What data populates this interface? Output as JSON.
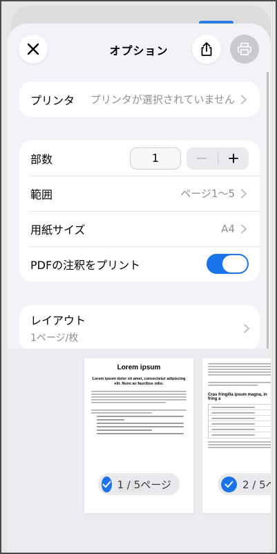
{
  "header": {
    "title": "オプション"
  },
  "printer": {
    "label": "プリンタ",
    "value": "プリンタが選択されていません"
  },
  "settings": {
    "copies_label": "部数",
    "copies_value": "1",
    "range_label": "範囲",
    "range_value": "ページ1〜5",
    "paper_label": "用紙サイズ",
    "paper_value": "A4",
    "annotations_label": "PDFの注釈をプリント",
    "annotations_on": true
  },
  "layout": {
    "label": "レイアウト",
    "value": "1ページ/枚"
  },
  "preview": {
    "page1": {
      "title": "Lorem ipsum",
      "subtitle": "Lorem ipsum dolor sit amet, consectetur adipiscing elit. Nunc ac faucibus odio.",
      "badge": "1 / 5ページ"
    },
    "page2": {
      "heading": "Cras fringilla ipsum magna, in fring a",
      "badge": "2 / 5ペ"
    }
  },
  "colors": {
    "accent": "#1a73e8",
    "sheet_bg": "#f2f2f7",
    "secondary_text": "#8e8e93"
  }
}
